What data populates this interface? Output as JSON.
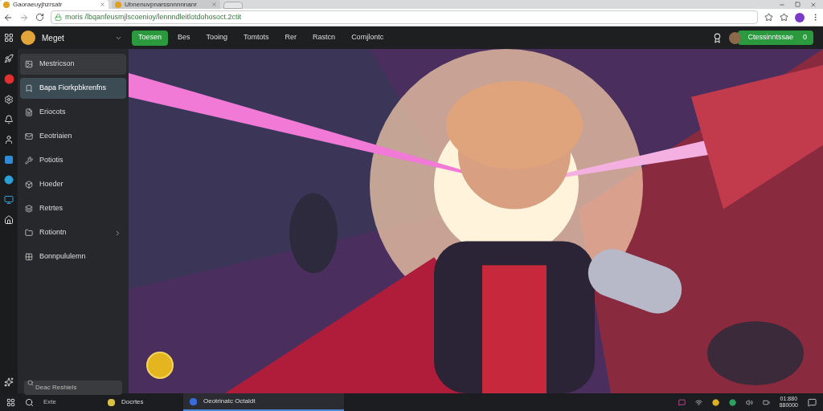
{
  "browser_tabs": [
    {
      "title": "Gaoraeuyjhzrsatr",
      "selected": true
    },
    {
      "title": "Ubnenuvpnarssnnnnnanr",
      "selected": false
    }
  ],
  "address_bar": {
    "url": "moris /lbqanfeusmjlscoenioy/lennndleitlotdohosoct.2ctit"
  },
  "app": {
    "brand": "Meget",
    "nav_tabs": [
      {
        "label": "Toesen",
        "selected": true
      },
      {
        "label": "Bes",
        "selected": false
      },
      {
        "label": "Tooing",
        "selected": false
      },
      {
        "label": "Tomtots",
        "selected": false
      },
      {
        "label": "Rer",
        "selected": false
      },
      {
        "label": "Rastcn",
        "selected": false
      },
      {
        "label": "Comjlontc",
        "selected": false
      }
    ],
    "user_button": {
      "label": "Ctessinntssae",
      "count": "0"
    },
    "sidebar": {
      "items": [
        {
          "label": "Mestricson",
          "selected": false,
          "hovered": true,
          "expandable": false
        },
        {
          "label": "Bapa Fiorkpbkrenfns",
          "selected": true,
          "hovered": false,
          "expandable": false
        },
        {
          "label": "Eriocots",
          "selected": false,
          "hovered": false,
          "expandable": false
        },
        {
          "label": "Eeotriaien",
          "selected": false,
          "hovered": false,
          "expandable": false
        },
        {
          "label": "Potiotis",
          "selected": false,
          "hovered": false,
          "expandable": false
        },
        {
          "label": "Hoeder",
          "selected": false,
          "hovered": false,
          "expandable": false
        },
        {
          "label": "Retrtes",
          "selected": false,
          "hovered": false,
          "expandable": false
        },
        {
          "label": "Rotiontn",
          "selected": false,
          "hovered": false,
          "expandable": true
        },
        {
          "label": "Bonnpululemn",
          "selected": false,
          "hovered": false,
          "expandable": false
        }
      ],
      "search": {
        "placeholder": "Deac Reshiels"
      }
    }
  },
  "taskbar": {
    "search_label": "Exte",
    "apps": [
      {
        "label": "Docrtes",
        "selected": false
      },
      {
        "label": "Oeotrinatc Octaldt",
        "selected": true
      }
    ],
    "clock": {
      "time": "01:880",
      "date": "880000"
    }
  }
}
